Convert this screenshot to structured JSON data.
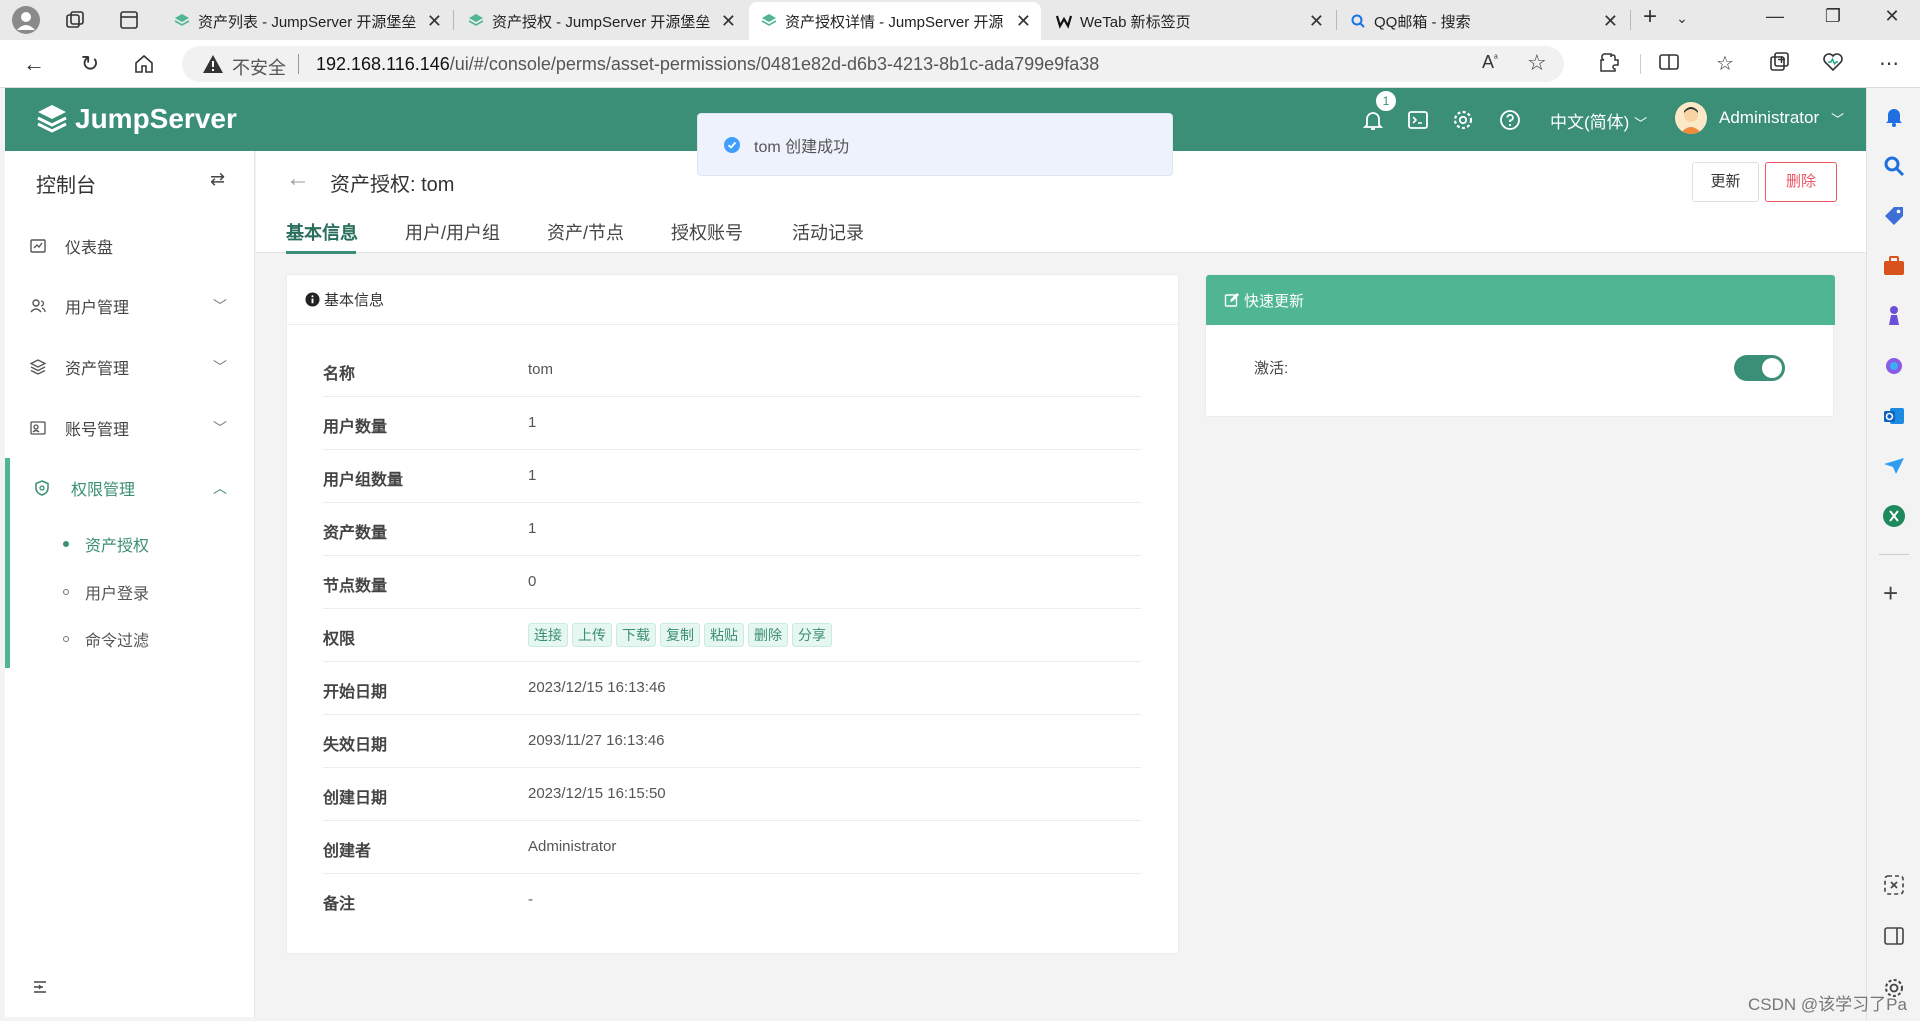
{
  "browser": {
    "tabs": [
      {
        "title": "资产列表 - JumpServer 开源堡垒"
      },
      {
        "title": "资产授权 - JumpServer 开源堡垒"
      },
      {
        "title": "资产授权详情 - JumpServer 开源"
      },
      {
        "title": "WeTab 新标签页"
      },
      {
        "title": "QQ邮箱 - 搜索"
      }
    ],
    "insecure_label": "不安全",
    "url_host": "192.168.116.146",
    "url_path": "/ui/#/console/perms/asset-permissions/0481e82d-d6b3-4213-8b1c-ada799e9fa38"
  },
  "header": {
    "logo_text": "JumpServer",
    "notification_count": "1",
    "language": "中文(简体)",
    "username": "Administrator"
  },
  "sidebar": {
    "title": "控制台",
    "items": [
      {
        "label": "仪表盘"
      },
      {
        "label": "用户管理"
      },
      {
        "label": "资产管理"
      },
      {
        "label": "账号管理"
      },
      {
        "label": "权限管理"
      }
    ],
    "subitems": [
      {
        "label": "资产授权"
      },
      {
        "label": "用户登录"
      },
      {
        "label": "命令过滤"
      }
    ]
  },
  "page": {
    "title": "资产授权: tom",
    "tabs": [
      {
        "label": "基本信息"
      },
      {
        "label": "用户/用户组"
      },
      {
        "label": "资产/节点"
      },
      {
        "label": "授权账号"
      },
      {
        "label": "活动记录"
      }
    ],
    "update_button": "更新",
    "delete_button": "删除"
  },
  "info": {
    "header": "基本信息",
    "rows": [
      {
        "key": "名称",
        "value": "tom"
      },
      {
        "key": "用户数量",
        "value": "1"
      },
      {
        "key": "用户组数量",
        "value": "1"
      },
      {
        "key": "资产数量",
        "value": "1"
      },
      {
        "key": "节点数量",
        "value": "0"
      },
      {
        "key": "权限",
        "value": ""
      },
      {
        "key": "开始日期",
        "value": "2023/12/15 16:13:46"
      },
      {
        "key": "失效日期",
        "value": "2093/11/27 16:13:46"
      },
      {
        "key": "创建日期",
        "value": "2023/12/15 16:15:50"
      },
      {
        "key": "创建者",
        "value": "Administrator"
      },
      {
        "key": "备注",
        "value": "-"
      }
    ],
    "permissions": [
      "连接",
      "上传",
      "下载",
      "复制",
      "粘贴",
      "删除",
      "分享"
    ]
  },
  "quick_update": {
    "header": "快速更新",
    "active_label": "激活:",
    "active": true
  },
  "toast": {
    "message": "tom 创建成功"
  },
  "watermark": "CSDN @该学习了Pa",
  "colors": {
    "brand": "#3a8f76",
    "quick_header": "#4fb592",
    "danger": "#ed5565"
  }
}
